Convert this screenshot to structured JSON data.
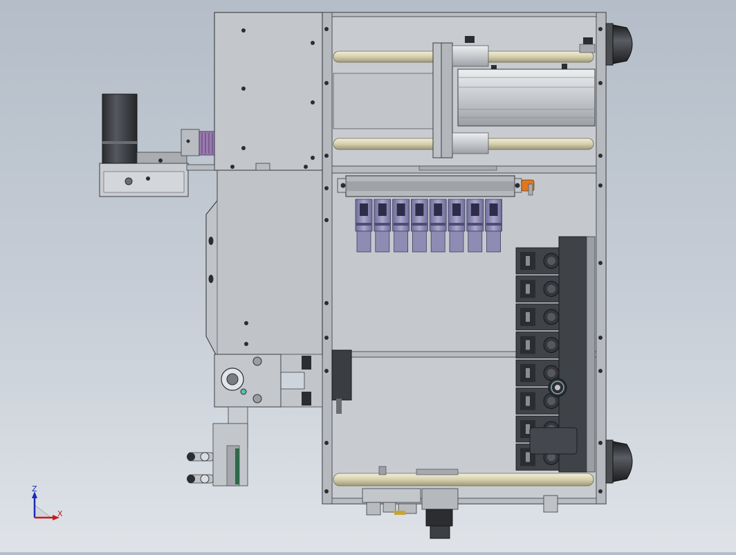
{
  "viewport": {
    "view": "front",
    "background_top": "#b4bdc8",
    "background_bottom": "#dfe3e8"
  },
  "triad": {
    "z_label": "Z",
    "x_label": "X",
    "z_color": "#1a2ab8",
    "x_color": "#c81a1a"
  },
  "model": {
    "frame_color": "#bcbfc3",
    "rod_color": "#d9d3b4",
    "valve_color": "#8e8cb3",
    "panel_color": "#3a3d42",
    "fitting_color": "#e07820",
    "cylinder_count": 8,
    "valve_block_count": 8
  }
}
